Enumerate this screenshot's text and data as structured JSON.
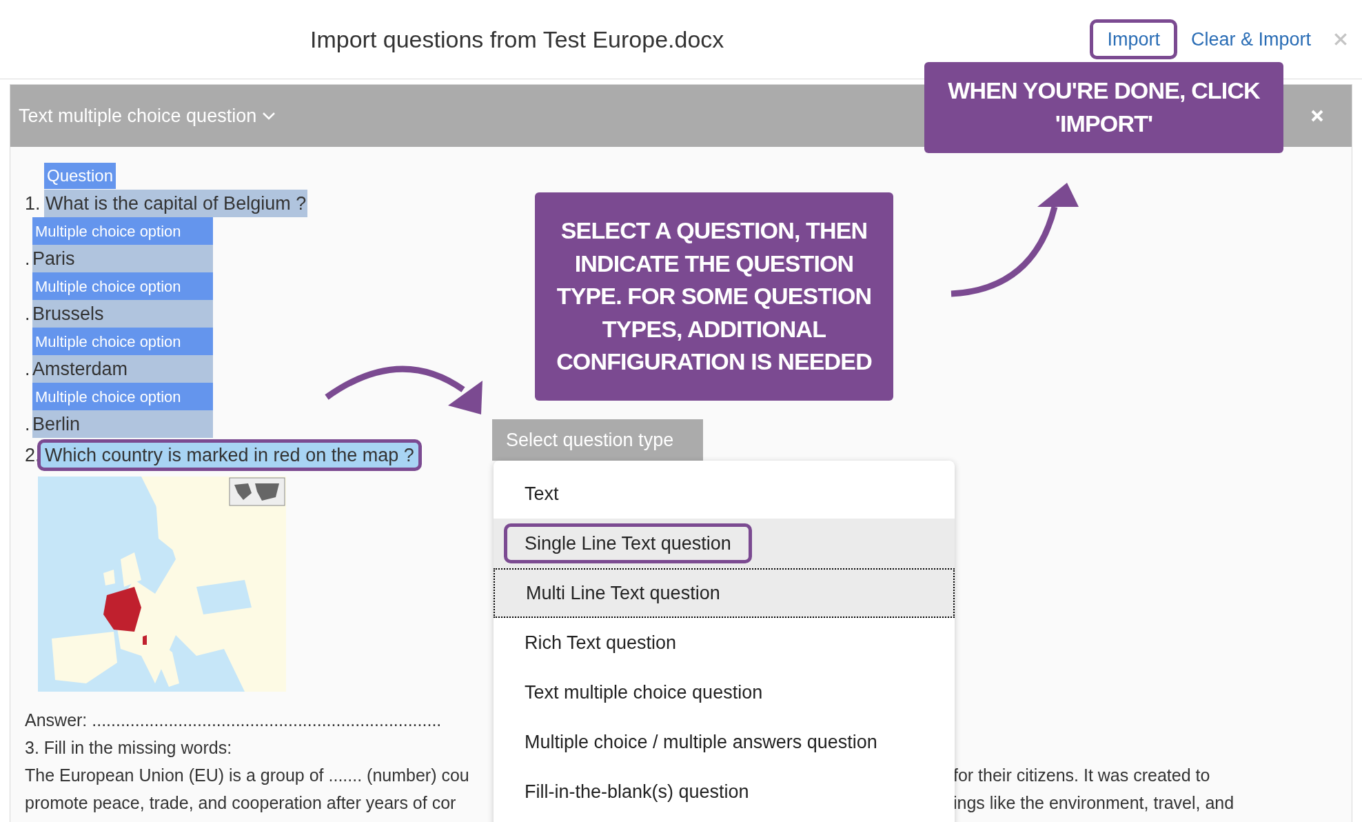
{
  "dialog": {
    "title": "Import questions from Test Europe.docx",
    "buttons": [
      {
        "label": "Import",
        "circled": true
      },
      {
        "label": "Clear & Import",
        "circled": false
      }
    ]
  },
  "panel": {
    "type_label": "Text multiple choice question"
  },
  "document": [
    {
      "kind": "tag",
      "text": "Question"
    },
    {
      "kind": "question",
      "number": "1.",
      "text": "What is the capital of Belgium ?",
      "selected": false,
      "circled": false
    },
    {
      "kind": "option_tag",
      "text": "Multiple choice option"
    },
    {
      "kind": "option",
      "number": ".",
      "text": "Paris"
    },
    {
      "kind": "option_tag",
      "text": "Multiple choice option"
    },
    {
      "kind": "option",
      "number": ".",
      "text": "Brussels"
    },
    {
      "kind": "option_tag",
      "text": "Multiple choice option"
    },
    {
      "kind": "option",
      "number": ".",
      "text": "Amsterdam"
    },
    {
      "kind": "option_tag",
      "text": "Multiple choice option"
    },
    {
      "kind": "option",
      "number": ".",
      "text": "Berlin"
    },
    {
      "kind": "question",
      "number": "2.",
      "text": "Which country is marked in red on the map ?",
      "selected": true,
      "circled": true
    },
    {
      "kind": "picture"
    },
    {
      "kind": "line",
      "text": "Answer: ........................................................................."
    },
    {
      "kind": "line",
      "text": "3. Fill in the missing words:"
    },
    {
      "kind": "split",
      "left": "The European Union (EU) is a group of ....... (number) cou",
      "right": "for their citizens. It was created to"
    },
    {
      "kind": "split",
      "left": "promote peace, trade, and cooperation after years of cor",
      "right": "ings like the environment, travel, and"
    }
  ],
  "type_select": {
    "label": "Select question type"
  },
  "type_menu": [
    {
      "label": "Text",
      "highlighted": false,
      "focused": false,
      "circled": false
    },
    {
      "label": "Single Line Text question",
      "highlighted": true,
      "focused": false,
      "circled": true
    },
    {
      "label": "Multi Line Text question",
      "highlighted": true,
      "focused": true,
      "circled": false
    },
    {
      "label": "Rich Text question",
      "highlighted": false,
      "focused": false,
      "circled": false
    },
    {
      "label": "Text multiple choice question",
      "highlighted": false,
      "focused": false,
      "circled": false
    },
    {
      "label": "Multiple choice / multiple answers question",
      "highlighted": false,
      "focused": false,
      "circled": false
    },
    {
      "label": "Fill-in-the-blank(s) question",
      "highlighted": false,
      "focused": false,
      "circled": false
    }
  ],
  "callouts": [
    {
      "text": "WHEN YOU'RE DONE, CLICK 'IMPORT'"
    },
    {
      "text": "SELECT A QUESTION, THEN INDICATE THE QUESTION TYPE. FOR SOME QUESTION TYPES, ADDITIONAL CONFIGURATION IS NEEDED"
    }
  ]
}
